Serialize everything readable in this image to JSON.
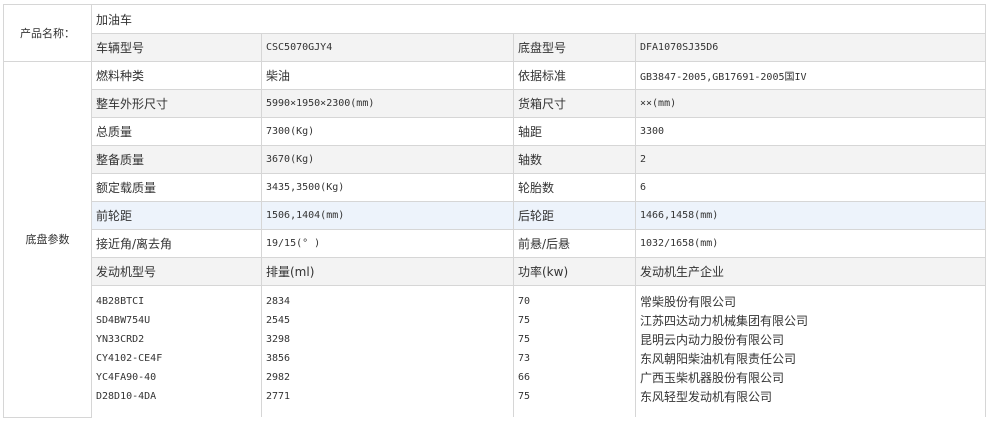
{
  "product": {
    "label": "产品名称：",
    "value": "加油车"
  },
  "vehicle_model": {
    "label": "车辆型号",
    "value": "CSC5070GJY4"
  },
  "chassis_model": {
    "label": "底盘型号",
    "value": "DFA1070SJ35D6"
  },
  "section_label": "底盘参数",
  "params": [
    {
      "l1": "燃料种类",
      "v1": "柴油",
      "l2": "依据标准",
      "v2": "GB3847-2005,GB17691-2005国IV"
    },
    {
      "l1": "整车外形尺寸",
      "v1": "5990×1950×2300(mm)",
      "l2": "货箱尺寸",
      "v2": "××(mm)"
    },
    {
      "l1": "总质量",
      "v1": "7300(Kg)",
      "l2": "轴距",
      "v2": "3300"
    },
    {
      "l1": "整备质量",
      "v1": "3670(Kg)",
      "l2": "轴数",
      "v2": "2"
    },
    {
      "l1": "额定载质量",
      "v1": "3435,3500(Kg)",
      "l2": "轮胎数",
      "v2": "6"
    },
    {
      "l1": "前轮距",
      "v1": "1506,1404(mm)",
      "l2": "后轮距",
      "v2": "1466,1458(mm)"
    },
    {
      "l1": "接近角/离去角",
      "v1": "19/15(° )",
      "l2": "前悬/后悬",
      "v2": "1032/1658(mm)"
    }
  ],
  "engine_header": {
    "model": "发动机型号",
    "displacement": "排量(ml)",
    "power": "功率(kw)",
    "maker": "发动机生产企业"
  },
  "engines": [
    {
      "model": "4B28BTCI",
      "displacement": "2834",
      "power": "70",
      "maker": "常柴股份有限公司"
    },
    {
      "model": "SD4BW754U",
      "displacement": "2545",
      "power": "75",
      "maker": "江苏四达动力机械集团有限公司"
    },
    {
      "model": "YN33CRD2",
      "displacement": "3298",
      "power": "75",
      "maker": "昆明云内动力股份有限公司"
    },
    {
      "model": "CY4102-CE4F",
      "displacement": "3856",
      "power": "73",
      "maker": "东风朝阳柴油机有限责任公司"
    },
    {
      "model": "YC4FA90-40",
      "displacement": "2982",
      "power": "66",
      "maker": "广西玉柴机器股份有限公司"
    },
    {
      "model": "D28D10-4DA",
      "displacement": "2771",
      "power": "75",
      "maker": "东风轻型发动机有限公司"
    }
  ]
}
